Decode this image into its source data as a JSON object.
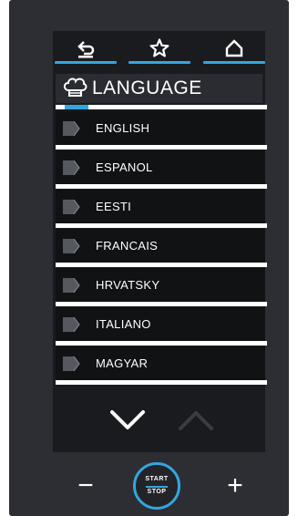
{
  "nav": {
    "back_icon": "back-arrow-icon",
    "favorite_icon": "star-icon",
    "home_icon": "home-icon"
  },
  "header": {
    "icon": "chef-hat-icon",
    "title": "LANGUAGE"
  },
  "languages": [
    "ENGLISH",
    "ESPANOL",
    "EESTI",
    "FRANCAIS",
    "HRVATSKY",
    "ITALIANO",
    "MAGYAR"
  ],
  "controls": {
    "minus": "−",
    "plus": "+",
    "start_label": "START",
    "stop_label": "STOP"
  },
  "colors": {
    "accent": "#33a6de",
    "panel": "#2c2e33",
    "screen": "#1a1b1e"
  }
}
